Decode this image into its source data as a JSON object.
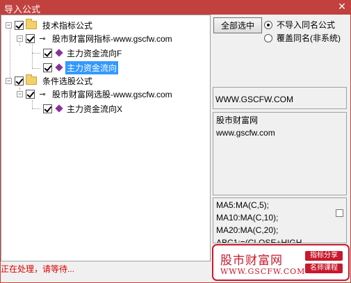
{
  "window": {
    "title": "导入公式"
  },
  "tree": {
    "groups": [
      {
        "label": "技术指标公式",
        "checked": true,
        "children": [
          {
            "label": "股市财富网指标-www.gscfw.com",
            "checked": true,
            "items": [
              {
                "label": "主力资金流向F",
                "checked": true,
                "selected": false
              },
              {
                "label": "主力资金流向",
                "checked": true,
                "selected": true
              }
            ]
          }
        ]
      },
      {
        "label": "条件选股公式",
        "checked": true,
        "children": [
          {
            "label": "股市财富网选股-www.gscfw.com",
            "checked": true,
            "items": [
              {
                "label": "主力资金流向X",
                "checked": true,
                "selected": false
              }
            ]
          }
        ]
      }
    ]
  },
  "controls": {
    "select_all_label": "全部选中",
    "radio_options": [
      {
        "label": "不导入同名公式",
        "selected": true
      },
      {
        "label": "覆盖同名(非系统)",
        "selected": false
      }
    ]
  },
  "info": {
    "site": "WWW.GSCFW.COM",
    "description_lines": [
      "股市财富网",
      "www.gscfw.com"
    ],
    "formula_lines": [
      "MA5:MA(C,5);",
      "MA10:MA(C,10);",
      "MA20:MA(C,20);",
      "ABC1:=(CLOSE+HIGH"
    ]
  },
  "status": {
    "text": "正在处理，请等待..."
  },
  "watermark": {
    "main": "股市财富网",
    "sub": "WWW.GSCFW.COM",
    "badges": [
      "指标分享",
      "名师课程"
    ],
    "color": "#c8192c"
  },
  "colors": {
    "titlebar": "#c0413e",
    "selection": "#3399ff",
    "status_text": "#dd0000"
  }
}
